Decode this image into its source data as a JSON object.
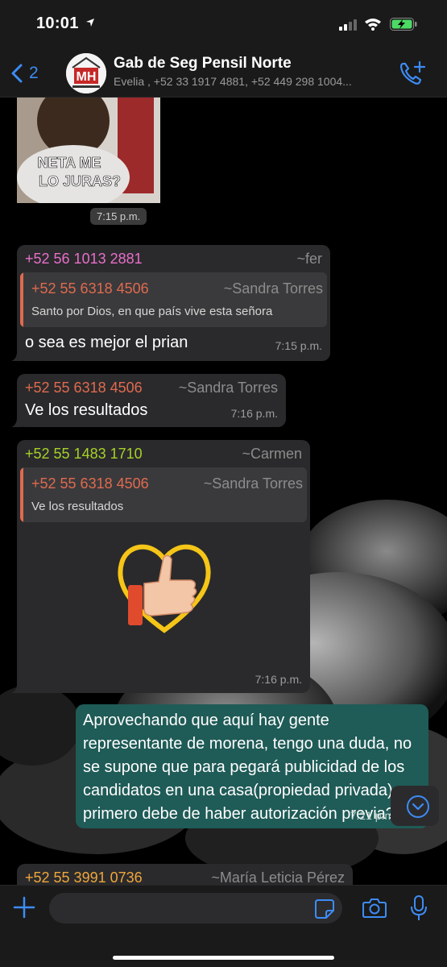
{
  "status_bar": {
    "time": "10:01"
  },
  "header": {
    "back_count": "2",
    "avatar_text": "MH",
    "group_title": "Gab de Seg Pensil Norte",
    "participants": "Evelia , +52 33 1917 4881, +52 449 298 1004..."
  },
  "messages": {
    "sticker": {
      "caption": "NETA ME\nLO JURAS?",
      "time": "7:15 p.m."
    },
    "m1": {
      "sender": "+52 56 1013 2881",
      "alias": "~fer",
      "sender_color": "#e86fc9",
      "quote_sender": "+52 55 6318 4506",
      "quote_alias": "~Sandra Torres",
      "quote_text": "Santo por Dios, en que país vive esta señora",
      "text": "o sea es mejor el prian",
      "time": "7:15 p.m."
    },
    "m2": {
      "sender": "+52 55 6318 4506",
      "alias": "~Sandra Torres",
      "sender_color": "#e06a4e",
      "text": "Ve los resultados",
      "time": "7:16 p.m."
    },
    "m3": {
      "sender": "+52 55 1483 1710",
      "alias": "~Carmen",
      "sender_color": "#a7d129",
      "quote_sender": "+52 55 6318 4506",
      "quote_alias": "~Sandra Torres",
      "quote_text": "Ve los resultados",
      "time": "7:16 p.m."
    },
    "out": {
      "text": "Aprovechando que aquí hay gente representante de morena, tengo una duda, no se supone que para pegará publicidad de los candidatos en una casa(propiedad privada) primero debe de haber autorización previa??",
      "time": "7:21 p.m."
    },
    "m4": {
      "sender": "+52 55 3991 0736",
      "alias": "~María Leticia Pérez",
      "sender_color": "#f0a63a"
    }
  },
  "input": {
    "placeholder": ""
  },
  "colors": {
    "accent": "#3d8cf5",
    "outgoing": "#1f5b57",
    "incoming": "#2a2a2c"
  }
}
